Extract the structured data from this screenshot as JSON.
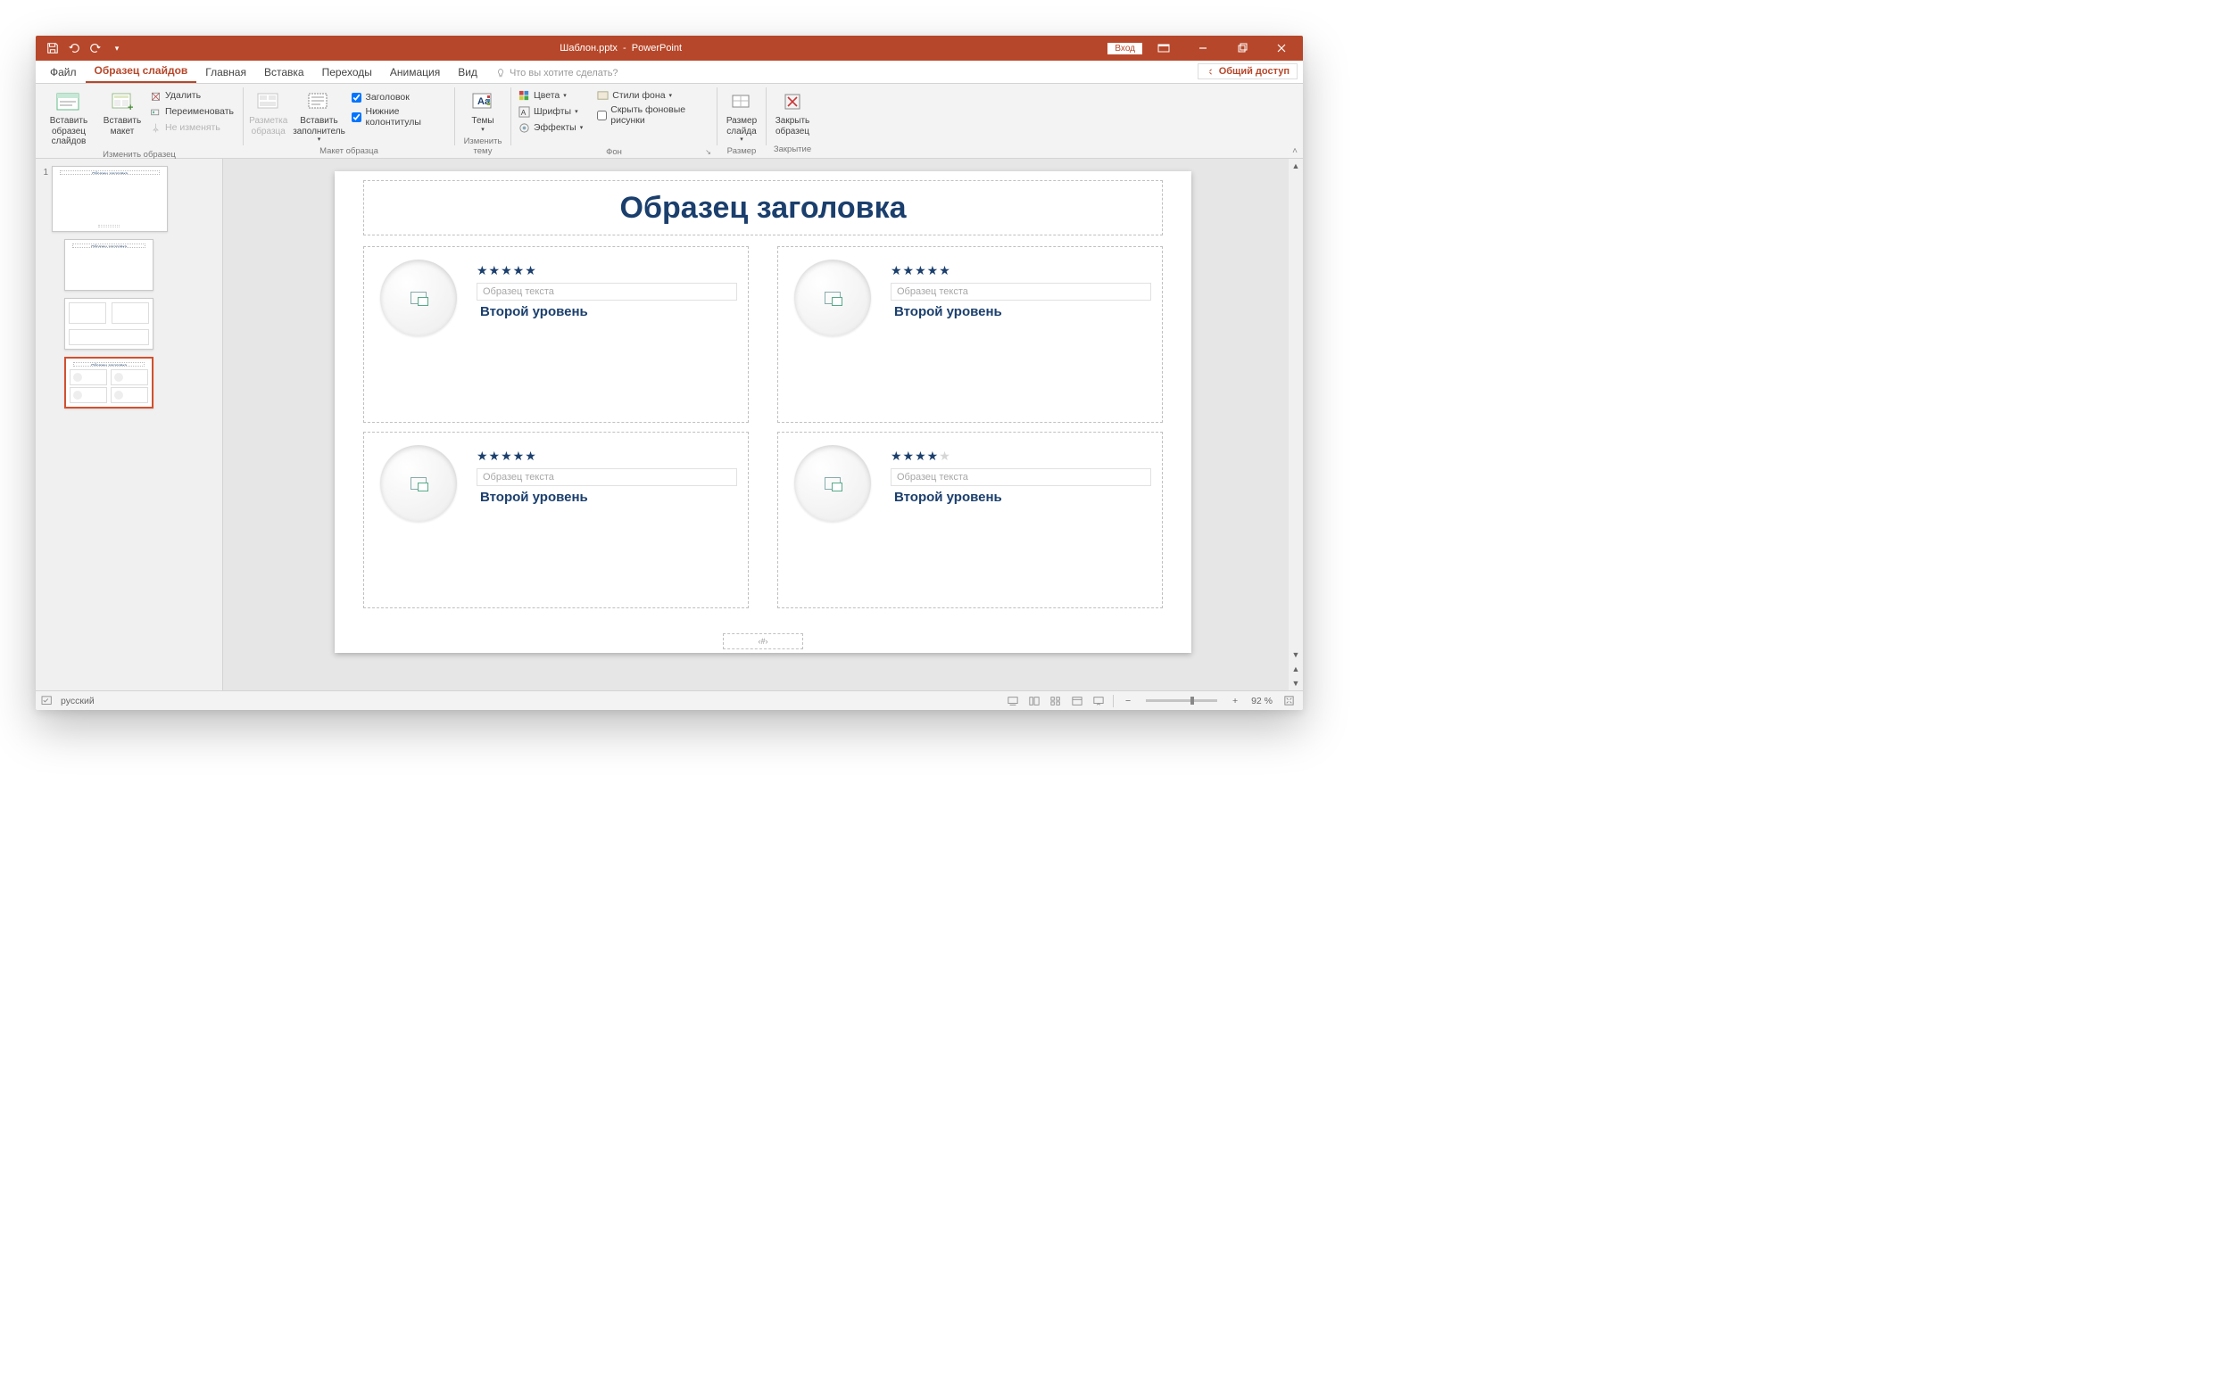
{
  "title": {
    "filename": "Шаблон.pptx",
    "app": "PowerPoint",
    "signin": "Вход"
  },
  "tabs": {
    "file": "Файл",
    "slidemaster": "Образец слайдов",
    "home": "Главная",
    "insert": "Вставка",
    "transitions": "Переходы",
    "animations": "Анимация",
    "view": "Вид",
    "tellme": "Что вы хотите сделать?",
    "share": "Общий доступ"
  },
  "ribbon": {
    "insert_master": "Вставить\nобразец слайдов",
    "insert_layout": "Вставить\nмакет",
    "delete": "Удалить",
    "rename": "Переименовать",
    "preserve": "Не изменять",
    "group_edit": "Изменить образец",
    "master_layout": "Разметка\nобразца",
    "insert_placeholder": "Вставить\nзаполнитель",
    "title_chk": "Заголовок",
    "footers_chk": "Нижние колонтитулы",
    "group_layout": "Макет образца",
    "themes": "Темы",
    "group_theme": "Изменить тему",
    "colors": "Цвета",
    "fonts": "Шрифты",
    "effects": "Эффекты",
    "bg_styles": "Стили фона",
    "hide_bg": "Скрыть фоновые рисунки",
    "group_bg": "Фон",
    "slide_size": "Размер\nслайда",
    "group_size": "Размер",
    "close_master": "Закрыть\nобразец",
    "group_close": "Закрытие"
  },
  "thumbs": {
    "master_num": "1",
    "title_mini": "Образец заголовка"
  },
  "slide": {
    "title": "Образец заголовка",
    "stars5": "★★★★★",
    "stars4": "★★★★",
    "star_empty": "★",
    "text_ph": "Образец текста",
    "level2": "Второй уровень",
    "pagenum": "‹#›"
  },
  "status": {
    "lang": "русский",
    "zoom": "92 %"
  }
}
